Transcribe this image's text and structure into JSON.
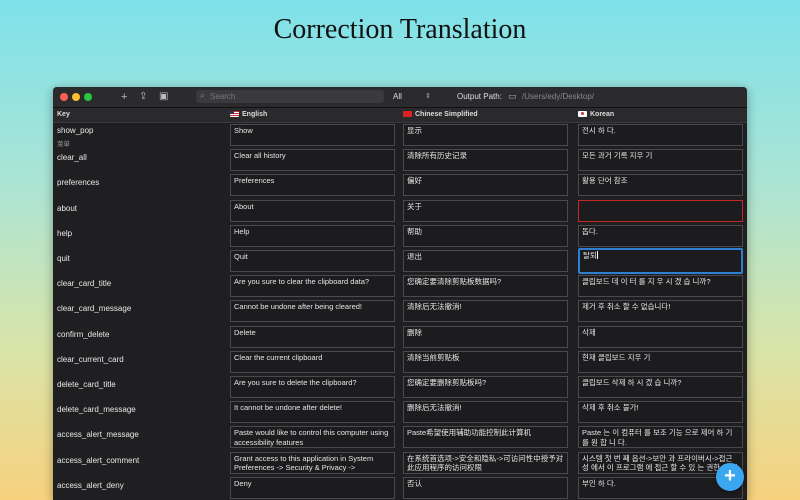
{
  "headline": "Correction Translation",
  "toolbar": {
    "search_placeholder": "Search",
    "filter_value": "All",
    "output_path_label": "Output Path:",
    "output_path": "/Users/edy/Desktop/"
  },
  "columns": {
    "key": "Key",
    "english": "English",
    "chinese": "Chinese Simplified",
    "korean": "Korean"
  },
  "rows": [
    {
      "key": "show_pop",
      "sub": "菜单",
      "en": "Show",
      "zh": "显示",
      "ko": "전시 하 다."
    },
    {
      "key": "clear_all",
      "en": "Clear all history",
      "zh": "清除所有历史记录",
      "ko": "모든 과거 기록 지우 기"
    },
    {
      "key": "preferences",
      "en": "Preferences",
      "zh": "偏好",
      "ko": "활용 단어 참조"
    },
    {
      "key": "about",
      "en": "About",
      "zh": "关于",
      "ko": ""
    },
    {
      "key": "help",
      "en": "Help",
      "zh": "帮助",
      "ko": "돕다."
    },
    {
      "key": "quit",
      "en": "Quit",
      "zh": "退出",
      "ko": "탈퇴"
    },
    {
      "key": "clear_card_title",
      "en": "Are you sure to clear the clipboard data?",
      "zh": "您确定要清除剪贴板数据吗?",
      "ko": "클립보드 데 이 터 를 지 우 시 겠 습 니까?"
    },
    {
      "key": "clear_card_message",
      "en": "Cannot be undone after being cleared!",
      "zh": "清除后无法撤消!",
      "ko": "제거 후 취소 할 수 없습니다!"
    },
    {
      "key": "confirm_delete",
      "en": "Delete",
      "zh": "删除",
      "ko": "삭제"
    },
    {
      "key": "clear_current_card",
      "en": "Clear the current clipboard",
      "zh": "清除当前剪贴板",
      "ko": "현재 클립보드 지우 기"
    },
    {
      "key": "delete_card_title",
      "en": "Are you sure to delete the clipboard?",
      "zh": "您确定要删除剪贴板吗?",
      "ko": "클립보드 삭제 하 시 겠 습 니까?"
    },
    {
      "key": "delete_card_message",
      "en": "It cannot be undone after delete!",
      "zh": "删除后无法撤消!",
      "ko": "삭제 후 취소 불가!"
    },
    {
      "key": "access_alert_message",
      "en": "Paste would like to control this computer using accessibility features",
      "zh": "Paste希望使用辅助功能控制此计算机",
      "ko": "Paste 는 이 컴퓨터 를 보조 기능 으로 제어 하 기 를 원 합 니 다."
    },
    {
      "key": "access_alert_comment",
      "en": "Grant access to this application in System Preferences -> Security & Privacy ->",
      "zh": "在系统首选项->安全和隐私->可访问性中授予对此应用程序的访问权限",
      "ko": "시스템 첫 번 째 옵션->보안 과 프라이버시->접근 성 에서 이 프로그램 에 접근 할 수 있 는 권한 을 부여"
    },
    {
      "key": "access_alert_deny",
      "en": "Deny",
      "zh": "否认",
      "ko": "부인 하 다."
    }
  ],
  "fab_label": "+"
}
